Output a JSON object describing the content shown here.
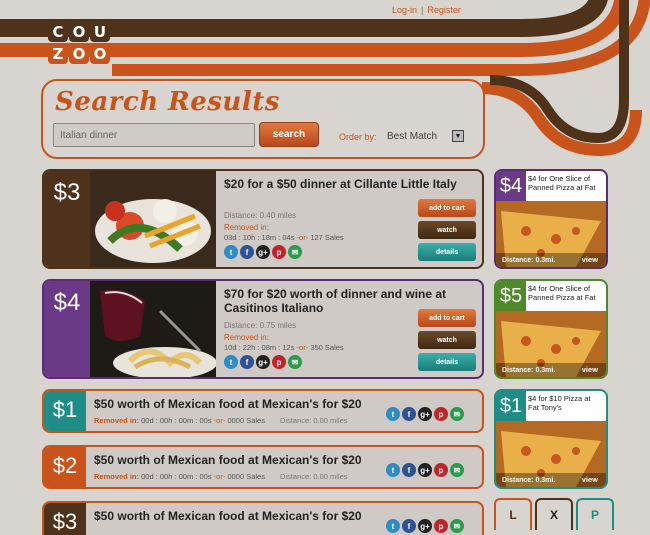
{
  "colors": {
    "orange": "#c8531b",
    "brown": "#4e3219",
    "purple": "#6b3a86",
    "teal": "#1f8c86",
    "green": "#4f8a2a"
  },
  "header": {
    "login": "Log-in",
    "separator": "|",
    "register": "Register"
  },
  "logo": {
    "row1": [
      "C",
      "O",
      "U"
    ],
    "row2": [
      "Z",
      "O",
      "O"
    ]
  },
  "search": {
    "title": "Search Results",
    "query": "Italian dinner",
    "button": "search",
    "order_label": "Order by:",
    "order_value": "Best Match",
    "dropdown_icon": "chevron-down-icon"
  },
  "deals": [
    {
      "price": "$3",
      "title": "$20 for a $50 dinner at Cillante Little Italy",
      "distance_label": "Distance:",
      "distance": "0.40 miles",
      "removed_label": "Removed in:",
      "countdown": "03d : 10h : 18m : 04s",
      "or": "-or-",
      "sales": "127 Sales",
      "add_to_cart": "add to cart",
      "watch": "watch",
      "details": "details"
    },
    {
      "price": "$4",
      "title": "$70 for $20 worth of dinner and wine at Casitinos Italiano",
      "distance_label": "Distance:",
      "distance": "0.75 miles",
      "removed_label": "Removed in:",
      "countdown": "10d : 22h : 08m : 12s",
      "or": "-or-",
      "sales": "350 Sales",
      "add_to_cart": "add to cart",
      "watch": "watch",
      "details": "details"
    }
  ],
  "small_deals": [
    {
      "price": "$1",
      "title": "$50 worth of Mexican food at Mexican's for $20",
      "removed_label": "Removed in:",
      "countdown": "00d : 00h : 00m : 00s",
      "or": "-or-",
      "sales": "0000 Sales",
      "distance": "Distance: 0.00 miles"
    },
    {
      "price": "$2",
      "title": "$50 worth of Mexican food at Mexican's for $20",
      "removed_label": "Removed in:",
      "countdown": "00d : 00h : 00m : 00s",
      "or": "-or-",
      "sales": "0000 Sales",
      "distance": "Distance: 0.00 miles"
    },
    {
      "price": "$3",
      "title": "$50 worth of Mexican food at Mexican's for $20"
    }
  ],
  "social": {
    "twitter": "t",
    "facebook": "f",
    "google": "g+",
    "pinterest": "p",
    "email": "✉"
  },
  "ads": [
    {
      "price": "$4",
      "text": "$4 for One Slice of Panned Pizza at Fat",
      "distance": "Distance: 0.3mi.",
      "view": "view"
    },
    {
      "price": "$5",
      "text": "$4 for One Slice of Panned Pizza at Fat",
      "distance": "Distance: 0.3mi.",
      "view": "view"
    },
    {
      "price": "$1",
      "text": "$4 for $10 Pizza at Fat Tony's",
      "distance": "Distance: 0.3mi.",
      "view": "view"
    }
  ],
  "tabs": [
    "L",
    "X",
    "P"
  ]
}
